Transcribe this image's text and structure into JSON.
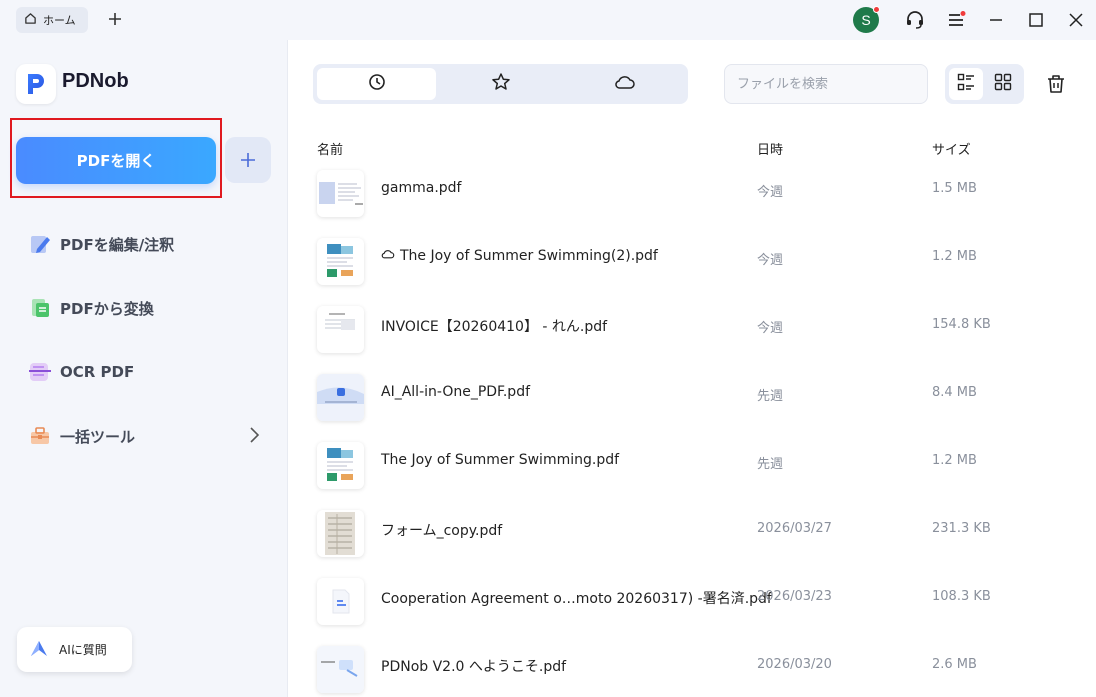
{
  "titlebar": {
    "home_tab_label": "ホーム",
    "avatar_initial": "S"
  },
  "sidebar": {
    "brand": "PDNob",
    "open_button": "PDFを開く",
    "items": [
      {
        "label": "PDFを編集/注釈",
        "icon": "edit-pdf-icon"
      },
      {
        "label": "PDFから変換",
        "icon": "convert-pdf-icon"
      },
      {
        "label": "OCR PDF",
        "icon": "ocr-icon"
      },
      {
        "label": "一括ツール",
        "icon": "toolbox-icon"
      }
    ],
    "ai_button": "AIに質問"
  },
  "main": {
    "search_placeholder": "ファイルを検索",
    "columns": {
      "name": "名前",
      "date": "日時",
      "size": "サイズ"
    },
    "files": [
      {
        "name": "gamma.pdf",
        "date": "今週",
        "size": "1.5 MB",
        "cloud": false
      },
      {
        "name": "The Joy of Summer Swimming(2).pdf",
        "date": "今週",
        "size": "1.2 MB",
        "cloud": true
      },
      {
        "name": "INVOICE【20260410】 - れん.pdf",
        "date": "今週",
        "size": "154.8 KB",
        "cloud": false
      },
      {
        "name": "AI_All-in-One_PDF.pdf",
        "date": "先週",
        "size": "8.4 MB",
        "cloud": false
      },
      {
        "name": "The Joy of Summer Swimming.pdf",
        "date": "先週",
        "size": "1.2 MB",
        "cloud": false
      },
      {
        "name": "フォーム_copy.pdf",
        "date": "2026/03/27",
        "size": "231.3 KB",
        "cloud": false
      },
      {
        "name": "Cooperation Agreement o…moto 20260317) -署名済.pdf",
        "date": "2026/03/23",
        "size": "108.3 KB",
        "cloud": false
      },
      {
        "name": "PDNob V2.0 へようこそ.pdf",
        "date": "2026/03/20",
        "size": "2.6 MB",
        "cloud": false
      }
    ]
  },
  "colors": {
    "accent": "#4a8bff",
    "sidebar_bg": "#f4f6fb",
    "highlight": "#e0191f"
  }
}
